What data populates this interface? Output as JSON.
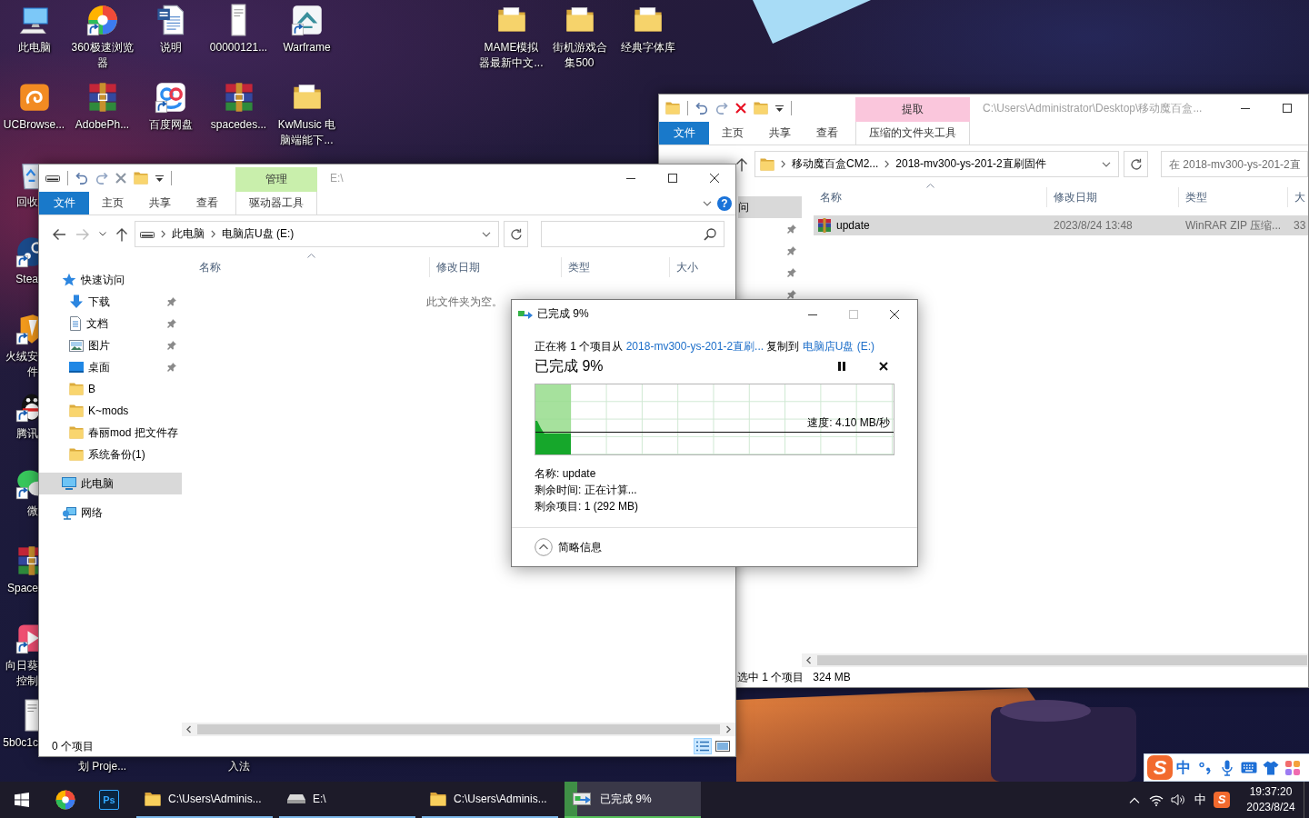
{
  "desktop": {
    "icons": [
      {
        "kind": "computer",
        "label": [
          "此电脑"
        ],
        "shortcut": false
      },
      {
        "kind": "swirl",
        "label": [
          "360极速浏览",
          "器"
        ],
        "shortcut": true
      },
      {
        "kind": "document",
        "label": [
          "说明"
        ],
        "shortcut": false
      },
      {
        "kind": "page",
        "label": [
          "00000121..."
        ],
        "shortcut": false
      },
      {
        "kind": "game",
        "label": [
          "Warframe"
        ],
        "shortcut": true
      },
      {
        "kind": "folder",
        "label": [
          "MAME模拟",
          "器最新中文..."
        ],
        "shortcut": false
      },
      {
        "kind": "folder",
        "label": [
          "街机游戏合",
          "集500"
        ],
        "shortcut": false
      },
      {
        "kind": "folder",
        "label": [
          "经典字体库"
        ],
        "shortcut": false
      },
      {
        "kind": "squirrel",
        "label": [
          "UCBrowse..."
        ],
        "shortcut": false
      },
      {
        "kind": "archive",
        "label": [
          "AdobePh..."
        ],
        "shortcut": false
      },
      {
        "kind": "cloud",
        "label": [
          "百度网盘"
        ],
        "shortcut": true
      },
      {
        "kind": "archive",
        "label": [
          "spacedes..."
        ],
        "shortcut": false
      },
      {
        "kind": "folder",
        "label": [
          "KwMusic 电",
          "脑端能下..."
        ],
        "shortcut": false
      },
      {
        "kind": "recycle",
        "label": [
          "回收"
        ],
        "shortcut": false
      },
      {
        "kind": "steam",
        "label": [
          "Stea"
        ],
        "shortcut": true
      },
      {
        "kind": "shield",
        "label": [
          "火绒安",
          "件"
        ],
        "shortcut": true
      },
      {
        "kind": "penguin",
        "label": [
          "腾讯"
        ],
        "shortcut": true
      },
      {
        "kind": "chat",
        "label": [
          "微"
        ],
        "shortcut": true
      },
      {
        "kind": "archive",
        "label": [
          "Space"
        ],
        "shortcut": false
      },
      {
        "kind": "remote",
        "label": [
          "向日葵",
          "控制"
        ],
        "shortcut": true
      },
      {
        "kind": "page",
        "label": [
          "5b0c1c"
        ],
        "shortcut": false
      },
      {
        "kind": "hidden",
        "label": [
          "划 Proje..."
        ]
      },
      {
        "kind": "hidden",
        "label": [
          "入法"
        ]
      }
    ]
  },
  "explorer_windows": [
    {
      "kind": "drive",
      "title": "E:\\",
      "active": false,
      "delete_disabled": true,
      "context_tab": {
        "kind": "drive",
        "header": "管理",
        "label": "驱动器工具"
      },
      "file_tab": "文件",
      "tabs": [
        "主页",
        "共享",
        "查看"
      ],
      "help": "?",
      "window_buttons": [
        {
          "kind": "minimize",
          "disabled": false
        },
        {
          "kind": "maximize",
          "disabled": false
        },
        {
          "kind": "close",
          "disabled": false
        }
      ],
      "nav_buttons": [
        {
          "kind": "back",
          "disabled": false
        },
        {
          "kind": "forward",
          "disabled": true
        },
        {
          "kind": "recent",
          "disabled": false
        },
        {
          "kind": "up",
          "disabled": false
        }
      ],
      "path": [
        "此电脑",
        "电脑店U盘 (E:)"
      ],
      "nav": [
        {
          "label": "快速访问",
          "kind": "star",
          "selected": false,
          "children": [
            {
              "label": "下载",
              "kind": "download",
              "pinned": true,
              "selected": false
            },
            {
              "label": "文档",
              "kind": "document",
              "pinned": true,
              "selected": false
            },
            {
              "label": "图片",
              "kind": "picture",
              "pinned": true,
              "selected": false
            },
            {
              "label": "桌面",
              "kind": "desktop",
              "pinned": true,
              "selected": false
            },
            {
              "label": "B",
              "kind": "folder",
              "pinned": false,
              "selected": false
            },
            {
              "label": "K~mods",
              "kind": "folder",
              "pinned": false,
              "selected": false
            },
            {
              "label": "春丽mod 把文件存",
              "kind": "folder",
              "pinned": false,
              "selected": false
            },
            {
              "label": "系统备份(1)",
              "kind": "folder",
              "pinned": false,
              "selected": false
            }
          ]
        },
        {
          "label": "此电脑",
          "kind": "computer",
          "selected": true
        },
        {
          "label": "网络",
          "kind": "network",
          "selected": false
        }
      ],
      "columns": [
        {
          "label": "名称",
          "sorted": true
        },
        {
          "label": "修改日期",
          "sorted": false
        },
        {
          "label": "类型",
          "sorted": false
        },
        {
          "label": "大小",
          "sorted": false
        }
      ],
      "empty_message": "此文件夹为空。",
      "status": [
        "0 个项目"
      ],
      "view_buttons": [
        {
          "kind": "details",
          "selected": true
        },
        {
          "kind": "tiles",
          "selected": false
        }
      ]
    },
    {
      "kind": "folder",
      "title": "C:\\Users\\Administrator\\Desktop\\移动魔百盒...",
      "active": false,
      "delete_disabled": false,
      "context_tab": {
        "kind": "archive",
        "header": "提取",
        "label": "压缩的文件夹工具"
      },
      "file_tab": "文件",
      "tabs": [
        "主页",
        "共享",
        "查看"
      ],
      "window_buttons": [
        {
          "kind": "minimize",
          "disabled": false
        },
        {
          "kind": "maximize",
          "disabled": false
        }
      ],
      "nav_buttons": [
        {
          "kind": "up",
          "disabled": false
        }
      ],
      "path": [
        "移动魔百盒CM2...",
        "2018-mv300-ys-201-2直刷固件"
      ],
      "search": {
        "placeholder": "在 2018-mv300-ys-201-2直"
      },
      "nav": [
        {
          "label": "问",
          "selected": true,
          "children": [
            {
              "pinned": true
            },
            {
              "pinned": true
            },
            {
              "pinned": true
            },
            {
              "pinned": true
            }
          ]
        }
      ],
      "columns": [
        {
          "label": "名称",
          "sorted": true
        },
        {
          "label": "修改日期",
          "sorted": false
        },
        {
          "label": "类型",
          "sorted": false
        },
        {
          "label": "大",
          "sorted": false
        }
      ],
      "rows": [
        {
          "kind": "archive",
          "selected": true,
          "cells": [
            "update",
            "2023/8/24 13:48",
            "WinRAR ZIP 压缩...",
            "33"
          ]
        }
      ],
      "status": [
        "选中 1 个项目",
        "324 MB"
      ]
    }
  ],
  "copy_dialog": {
    "title": "已完成 9%",
    "active": true,
    "window_buttons": [
      {
        "kind": "minimize",
        "disabled": false
      },
      {
        "kind": "maximize",
        "disabled": true
      },
      {
        "kind": "close",
        "disabled": false
      }
    ],
    "message": {
      "before": "正在将 1 个项目从 ",
      "source": "2018-mv300-ys-201-2直刷...",
      "middle": " 复制到 ",
      "destination": "电脑店U盘 (E:)"
    },
    "progress_title": "已完成 9%",
    "level": 0.1,
    "speed": "速度: 4.10 MB/秒",
    "details": [
      "名称: update",
      "剩余时间: 正在计算...",
      "剩余项目: 1 (292 MB)"
    ],
    "toggle": "简略信息"
  },
  "ime_toolbar": {
    "logo": "S",
    "mode": "中"
  },
  "taskbar": {
    "pinned": [
      {
        "kind": "swirl"
      },
      {
        "kind": "photoshop",
        "text": "Ps"
      }
    ],
    "tasks": [
      {
        "kind": "folder",
        "label": "C:\\Users\\Adminis...",
        "active": false
      },
      {
        "kind": "drive",
        "label": "E:\\",
        "active": false
      },
      {
        "kind": "folder",
        "label": "C:\\Users\\Adminis...",
        "active": false
      },
      {
        "kind": "copy",
        "label": "已完成 9%",
        "active": true,
        "level": 0.09
      }
    ],
    "tray": {
      "input_mode": "中",
      "ime_logo": "S",
      "time": "19:37:20",
      "date": "2023/8/24"
    }
  }
}
